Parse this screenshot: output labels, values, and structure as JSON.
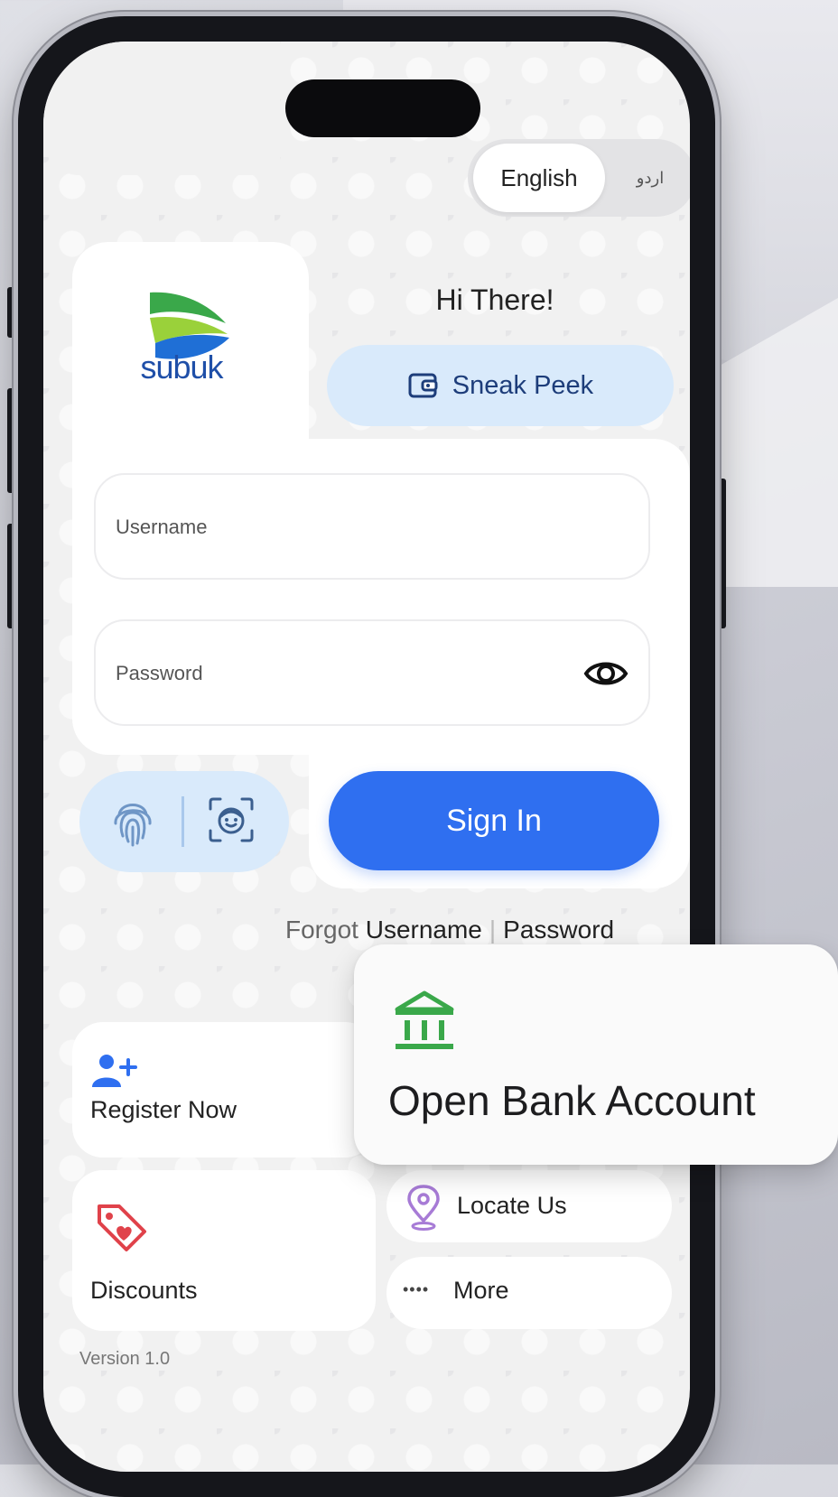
{
  "language": {
    "active": "English",
    "alternate": "اردو"
  },
  "brand": {
    "name": "subuk"
  },
  "greeting": "Hi There!",
  "sneak_peek": {
    "label": "Sneak Peek"
  },
  "form": {
    "username_placeholder": "Username",
    "password_placeholder": "Password"
  },
  "sign_in": {
    "label": "Sign In"
  },
  "forgot": {
    "prefix": "Forgot",
    "username": "Username",
    "separator": "|",
    "password": "Password"
  },
  "tiles": {
    "register": "Register Now",
    "open_bank_account": "Open Bank Account",
    "discounts": "Discounts",
    "locate": "Locate Us",
    "more": "More",
    "more_dots": "••••"
  },
  "version": "Version 1.0",
  "colors": {
    "primary_blue": "#2f6ff0",
    "light_blue": "#d9eafb",
    "brand_green": "#3aa84a",
    "brand_blue": "#1f4fa8",
    "accent_red": "#e0424a",
    "accent_purple": "#a77bd6"
  },
  "icons": [
    "eye-icon",
    "fingerprint-icon",
    "face-id-icon",
    "wallet-icon",
    "add-user-icon",
    "bank-icon",
    "tag-icon",
    "location-pin-icon"
  ]
}
